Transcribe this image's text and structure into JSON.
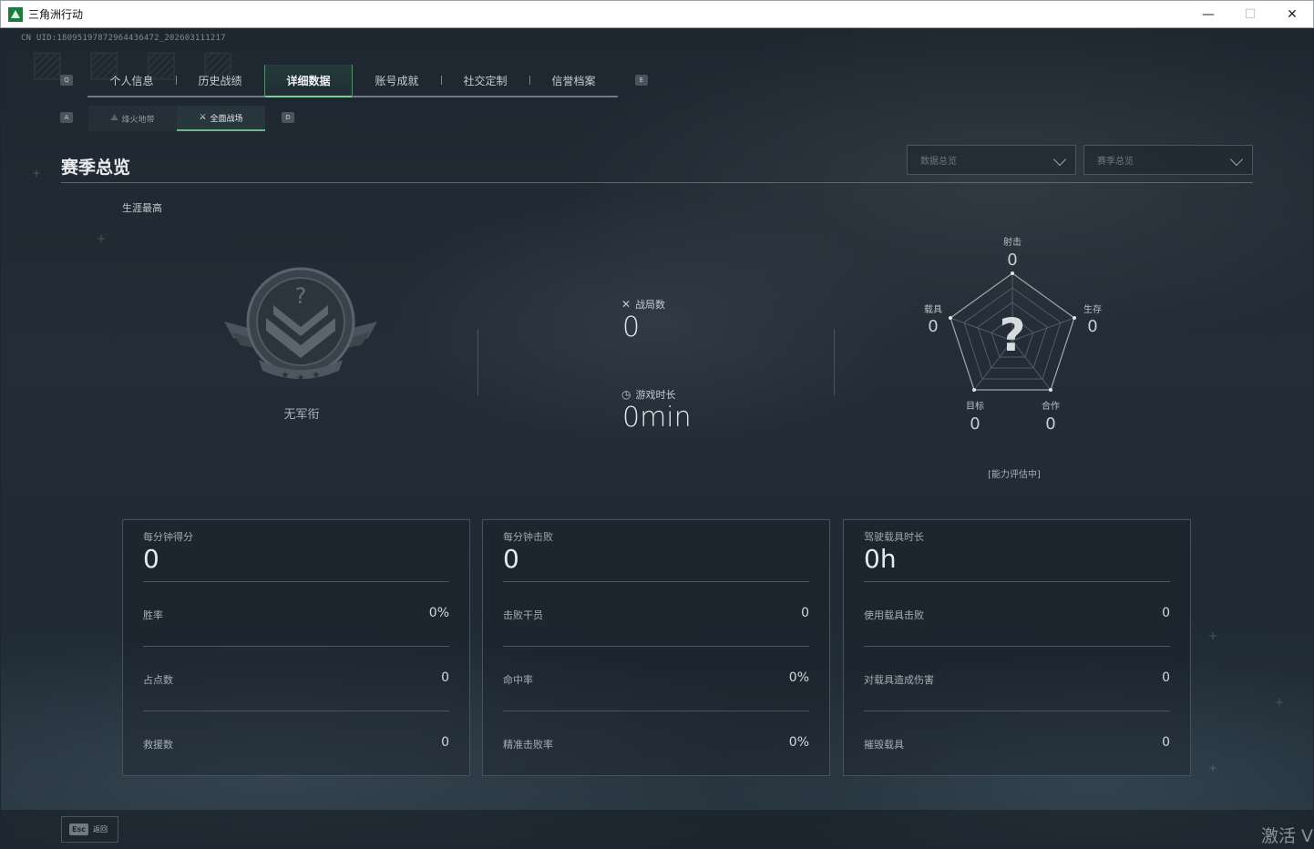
{
  "window": {
    "title": "三角洲行动",
    "controls": [
      "—",
      "☐",
      "✕"
    ]
  },
  "uid": "CN UID:18095197872964436472_202603111217",
  "tabs": {
    "key_left": "Q",
    "key_right": "E",
    "items": [
      {
        "label": "个人信息"
      },
      {
        "label": "历史战绩"
      },
      {
        "label": "详细数据",
        "active": true
      },
      {
        "label": "账号成就"
      },
      {
        "label": "社交定制"
      },
      {
        "label": "信誉档案"
      }
    ]
  },
  "subtabs": {
    "key_left": "A",
    "key_right": "D",
    "items": [
      {
        "label": "烽火地带",
        "icon": "⟁"
      },
      {
        "label": "全面战场",
        "icon": "⚔",
        "active": true
      }
    ]
  },
  "section": {
    "title": "赛季总览",
    "dropdowns": [
      {
        "label": "数据总览"
      },
      {
        "label": "赛季总览"
      }
    ]
  },
  "career": {
    "label": "生涯最高",
    "rank_name": "无军衔",
    "rank_icon": "rank-unknown-emblem"
  },
  "summary": {
    "matches_label": "战局数",
    "matches_value": "0",
    "playtime_label": "游戏时长",
    "playtime_value": "0min"
  },
  "radar": {
    "center_mark": "?",
    "status": "[能力评估中]",
    "axes": [
      {
        "label": "射击",
        "value": "0"
      },
      {
        "label": "生存",
        "value": "0"
      },
      {
        "label": "合作",
        "value": "0"
      },
      {
        "label": "目标",
        "value": "0"
      },
      {
        "label": "载具",
        "value": "0"
      }
    ]
  },
  "cards": [
    {
      "head_label": "每分钟得分",
      "head_value": "0",
      "rows": [
        {
          "label": "胜率",
          "value": "0%"
        },
        {
          "label": "占点数",
          "value": "0"
        },
        {
          "label": "救援数",
          "value": "0"
        }
      ]
    },
    {
      "head_label": "每分钟击败",
      "head_value": "0",
      "rows": [
        {
          "label": "击败干员",
          "value": "0"
        },
        {
          "label": "命中率",
          "value": "0%"
        },
        {
          "label": "精准击败率",
          "value": "0%"
        }
      ]
    },
    {
      "head_label": "驾驶载具时长",
      "head_value": "0h",
      "rows": [
        {
          "label": "使用载具击败",
          "value": "0"
        },
        {
          "label": "对载具造成伤害",
          "value": "0"
        },
        {
          "label": "摧毁载具",
          "value": "0"
        }
      ]
    }
  ],
  "footer": {
    "esc_key": "Esc",
    "esc_label": "返回",
    "activate_text": "激活 V"
  },
  "colors": {
    "accent": "#7ad09b",
    "background": "#1f2a34"
  }
}
